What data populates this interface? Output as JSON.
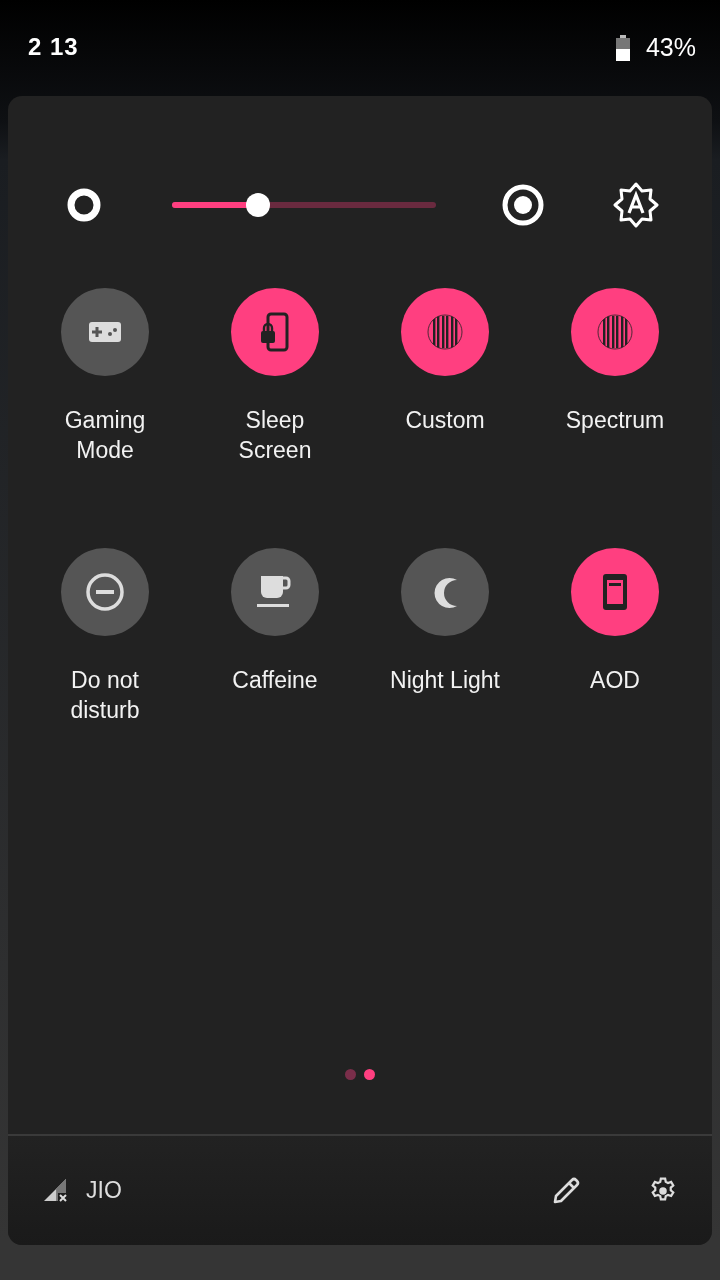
{
  "status_bar": {
    "time": "2 13",
    "battery_percent": "43%"
  },
  "brightness": {
    "level": 0.326,
    "auto": true
  },
  "tiles": [
    {
      "label": "Gaming Mode",
      "on": false
    },
    {
      "label": "Sleep Screen",
      "on": true
    },
    {
      "label": "Custom",
      "on": true
    },
    {
      "label": "Spectrum",
      "on": true
    },
    {
      "label": "Do not disturb",
      "on": false
    },
    {
      "label": "Caffeine",
      "on": false
    },
    {
      "label": "Night Light",
      "on": false
    },
    {
      "label": "AOD",
      "on": true
    }
  ],
  "pages": [
    {
      "selected": false
    },
    {
      "selected": true
    }
  ],
  "footer": {
    "carrier": "JIO"
  }
}
